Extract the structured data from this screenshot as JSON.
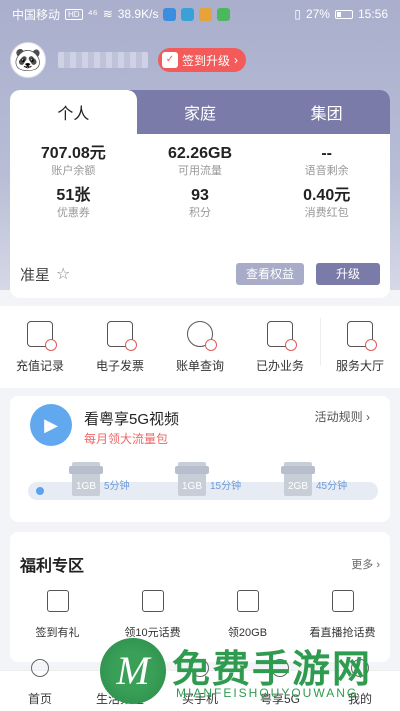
{
  "status_bar": {
    "carrier": "中国移动",
    "hd_badge": "HD",
    "signal": "⁴⁶",
    "speed": "38.9K/s",
    "battery": "27%",
    "time": "15:56"
  },
  "user": {
    "signin_label": "签到升级",
    "signin_arrow": "›"
  },
  "account_tabs": [
    "个人",
    "家庭",
    "集团"
  ],
  "stats": [
    {
      "value": "707.08元",
      "label": "账户余额"
    },
    {
      "value": "62.26GB",
      "label": "可用流量"
    },
    {
      "value": "--",
      "label": "语音剩余"
    },
    {
      "value": "51张",
      "label": "优惠券"
    },
    {
      "value": "93",
      "label": "积分"
    },
    {
      "value": "0.40元",
      "label": "消费红包"
    }
  ],
  "level": {
    "label": "准星",
    "star_icon": "☆",
    "rights_button": "查看权益",
    "upgrade_button": "升级"
  },
  "services": [
    "充值记录",
    "电子发票",
    "账单查询",
    "已办业务",
    "服务大厅"
  ],
  "promo": {
    "title": "看粤享5G视频",
    "subtitle": "每月领大流量包",
    "rules": "活动规则 ›",
    "milestones": [
      {
        "gift": "1GB",
        "minutes": "5分钟"
      },
      {
        "gift": "1GB",
        "minutes": "15分钟"
      },
      {
        "gift": "2GB",
        "minutes": "45分钟"
      }
    ]
  },
  "benefits": {
    "title": "福利专区",
    "more": "更多 ›",
    "items": [
      "签到有礼",
      "领10元话费",
      "领20GB",
      "看直播抢话费"
    ]
  },
  "bottom_nav": [
    "首页",
    "生活频道",
    "买手机",
    "粤享5G",
    "我的"
  ],
  "watermark": {
    "logo_letter": "M",
    "text": "免费手游网",
    "url": "MIANFEISHOUYOUWANG"
  },
  "colors": {
    "tab_bar": "#7a7ba8",
    "signin_red": "#f35a5a",
    "hero_bg": "#a9afcc",
    "accent_blue": "#62a8ef",
    "watermark_green": "#2e9b4f"
  }
}
